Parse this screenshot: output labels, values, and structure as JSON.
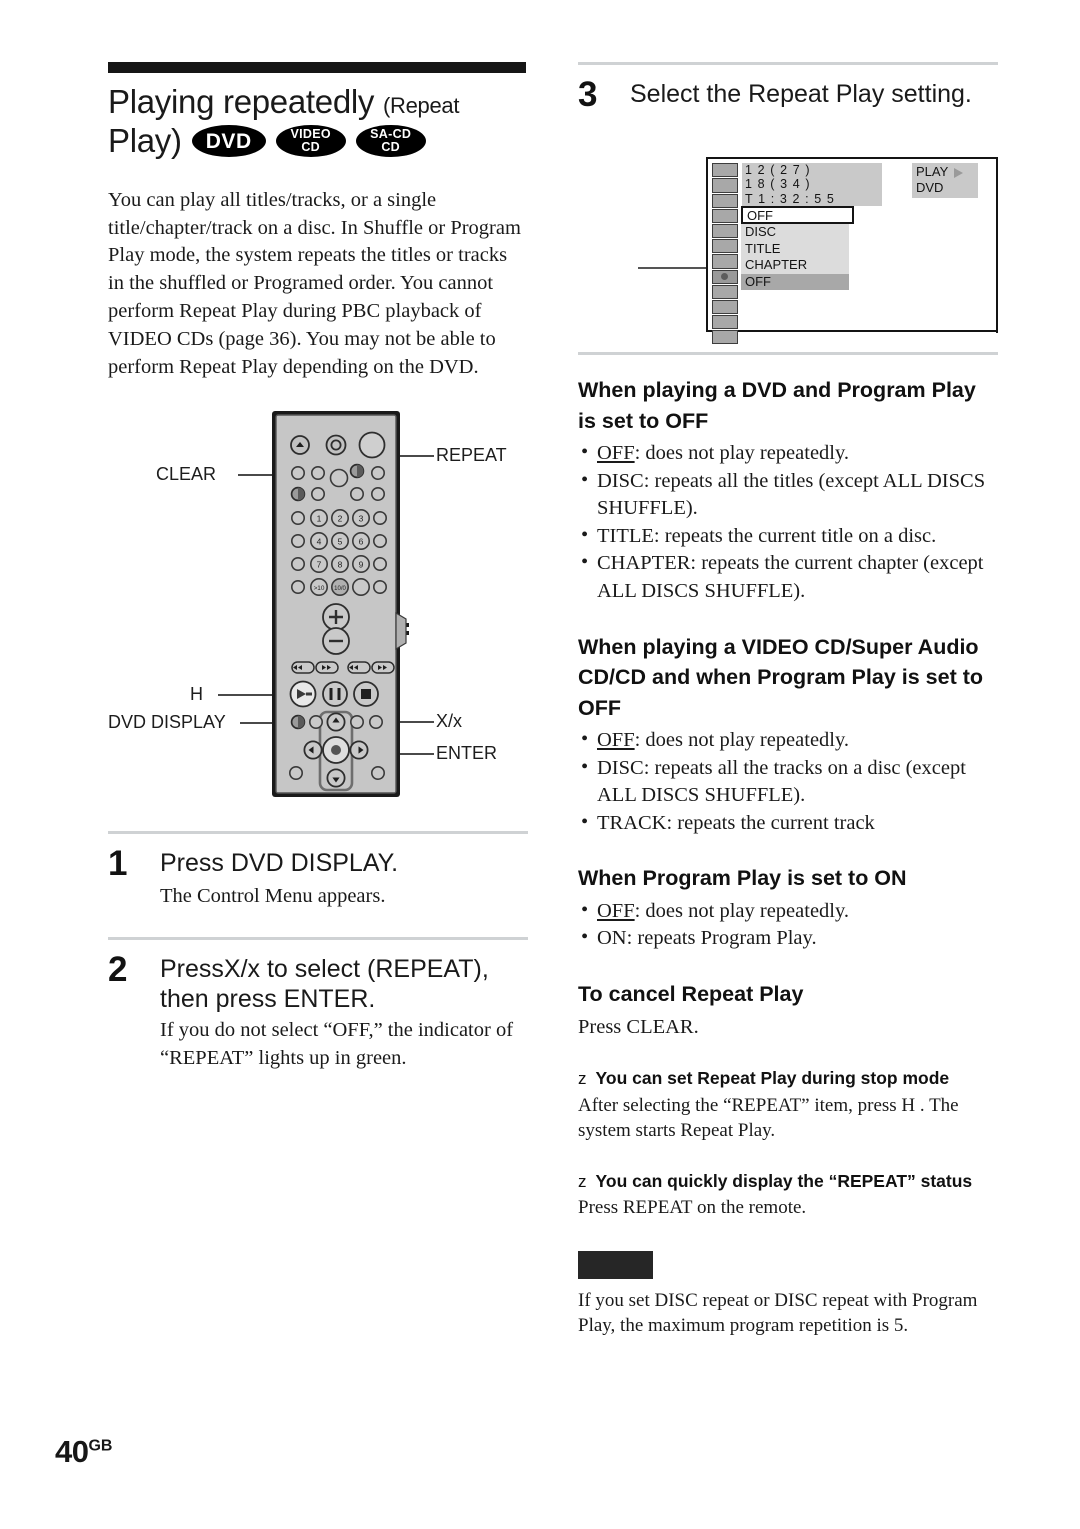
{
  "header": {
    "title_main": "Playing repeatedly",
    "title_suffix_line1": "(Repeat",
    "title_suffix_line2": "Play)",
    "badges": [
      {
        "name": "dvd",
        "line1": "DVD",
        "line2": ""
      },
      {
        "name": "video-cd",
        "line1": "VIDEO",
        "line2": "CD"
      },
      {
        "name": "sa-cd-cd",
        "line1": "SA-CD",
        "line2": "CD"
      }
    ]
  },
  "intro": {
    "paragraph": "You can play all titles/tracks, or a single title/chapter/track on a disc. In Shuffle or Program Play mode, the system repeats the titles or tracks in the shuffled or Programed order. You cannot perform Repeat Play during PBC playback of VIDEO CDs (page 36). You may not be able to perform Repeat Play depending on the DVD."
  },
  "remote": {
    "labels": {
      "clear": "CLEAR",
      "repeat": "REPEAT",
      "h": "H",
      "dvd_display": "DVD DISPLAY",
      "x_x": "X/x",
      "enter": "ENTER"
    },
    "number_keys": [
      "1",
      "2",
      "3",
      "4",
      "5",
      "6",
      "7",
      "8",
      "9",
      ">10",
      "10/0"
    ]
  },
  "steps": [
    {
      "number": "1",
      "title": "Press DVD DISPLAY.",
      "body": "The Control Menu appears."
    },
    {
      "number": "2",
      "title": "PressX/x  to select (REPEAT), then press ENTER.",
      "body": "If you do not select “OFF,” the indicator of “REPEAT” lights up in green."
    },
    {
      "number": "3",
      "title": "Select the Repeat Play setting.",
      "body": ""
    }
  ],
  "osd": {
    "info_line1": "1 2 ( 2 7 )",
    "info_line2": "1 8 ( 3 4 )",
    "info_line3": "T   1 : 3 2 : 5 5",
    "current_value": "OFF",
    "options": [
      "DISC",
      "TITLE",
      "CHAPTER",
      "OFF"
    ],
    "highlighted_option": "OFF",
    "status_line1": "PLAY",
    "status_line2": "DVD"
  },
  "sections": [
    {
      "heading": "When playing a DVD and Program Play is set to OFF",
      "bullets": [
        {
          "term": "OFF",
          "underline": true,
          "rest": ": does not play repeatedly."
        },
        {
          "term": "DISC",
          "underline": false,
          "rest": ": repeats all the titles (except ALL DISCS SHUFFLE)."
        },
        {
          "term": "TITLE",
          "underline": false,
          "rest": ": repeats the current title on a disc."
        },
        {
          "term": "CHAPTER",
          "underline": false,
          "rest": ": repeats the current chapter (except ALL DISCS SHUFFLE)."
        }
      ]
    },
    {
      "heading": "When playing a VIDEO CD/Super Audio CD/CD and when Program Play is set to OFF",
      "bullets": [
        {
          "term": "OFF",
          "underline": true,
          "rest": ": does not play repeatedly."
        },
        {
          "term": "DISC",
          "underline": false,
          "rest": ": repeats all the tracks on a disc (except ALL DISCS SHUFFLE)."
        },
        {
          "term": "TRACK",
          "underline": false,
          "rest": ": repeats the current track"
        }
      ]
    },
    {
      "heading": "When Program Play is set to ON",
      "bullets": [
        {
          "term": "OFF",
          "underline": true,
          "rest": ": does not play repeatedly."
        },
        {
          "term": "ON",
          "underline": false,
          "rest": ": repeats Program Play."
        }
      ]
    }
  ],
  "cancel": {
    "heading": "To cancel Repeat Play",
    "body": "Press CLEAR."
  },
  "tips": [
    {
      "marker": "z",
      "heading": "You can set Repeat Play during stop mode",
      "body": "After selecting the “REPEAT” item, press H  . The system starts Repeat Play."
    },
    {
      "marker": "z",
      "heading": "You can quickly display the “REPEAT” status",
      "body": "Press REPEAT on the remote."
    }
  ],
  "note": {
    "body": "If you set DISC repeat or DISC repeat with Program Play, the maximum program repetition is 5."
  },
  "footer": {
    "page_number": "40",
    "region": "GB"
  }
}
